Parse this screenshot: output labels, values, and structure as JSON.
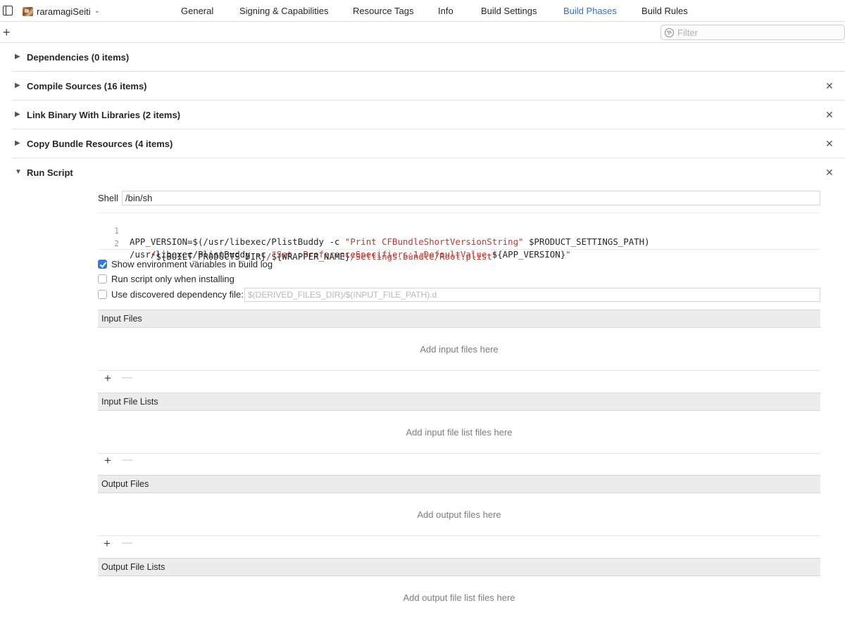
{
  "target": {
    "name": "raramagiSeiti"
  },
  "tabs": [
    {
      "label": "General"
    },
    {
      "label": "Signing & Capabilities"
    },
    {
      "label": "Resource Tags"
    },
    {
      "label": "Info"
    },
    {
      "label": "Build Settings"
    },
    {
      "label": "Build Phases"
    },
    {
      "label": "Build Rules"
    }
  ],
  "active_tab": "Build Phases",
  "accent_color": "#2f6fd6",
  "filter": {
    "placeholder": "Filter",
    "value": ""
  },
  "phases": [
    {
      "title": "Dependencies (0 items)",
      "expanded": false,
      "removable": false
    },
    {
      "title": "Compile Sources (16 items)",
      "expanded": false,
      "removable": true
    },
    {
      "title": "Link Binary With Libraries (2 items)",
      "expanded": false,
      "removable": true
    },
    {
      "title": "Copy Bundle Resources (4 items)",
      "expanded": false,
      "removable": true
    },
    {
      "title": "Run Script",
      "expanded": true,
      "removable": true
    }
  ],
  "run_script": {
    "shell_label": "Shell",
    "shell_value": "/bin/sh",
    "code": {
      "line1_num": "1",
      "line1_a": "APP_VERSION=$(/usr/libexec/PlistBuddy -c ",
      "line1_str": "\"Print CFBundleShortVersionString\"",
      "line1_b": " $PRODUCT_SETTINGS_PATH)",
      "line2_num": "2",
      "line2_a": "/usr/libexec/PlistBuddy -c ",
      "line2_str": "\"Set :PreferenceSpecifiers:1:DefaultValue ",
      "line2_b": "${APP_VERSION}",
      "line2_str2": "\"",
      "line3_str": "    \"",
      "line3_b": "${BUILT_PRODUCTS_DIR}",
      "line3_str2": "/",
      "line3_c": "${WRAPPER_NAME}",
      "line3_str3": "/Settings.bundle/Root.plist\""
    },
    "options": {
      "show_env": {
        "label": "Show environment variables in build log",
        "checked": true
      },
      "install_only": {
        "label": "Run script only when installing",
        "checked": false
      },
      "dep_file": {
        "label": "Use discovered dependency file:",
        "checked": false,
        "placeholder": "$(DERIVED_FILES_DIR)/$(INPUT_FILE_PATH).d"
      }
    },
    "sections": {
      "input_files": {
        "title": "Input Files",
        "empty": "Add input files here"
      },
      "input_file_lists": {
        "title": "Input File Lists",
        "empty": "Add input file list files here"
      },
      "output_files": {
        "title": "Output Files",
        "empty": "Add output files here"
      },
      "output_file_lists": {
        "title": "Output File Lists",
        "empty": "Add output file list files here"
      }
    }
  },
  "icons": {
    "disclosure_collapsed": "▶",
    "disclosure_expanded": "▼",
    "close": "✕",
    "plus": "+",
    "minus": "—",
    "chevron": "⌃⌄"
  }
}
